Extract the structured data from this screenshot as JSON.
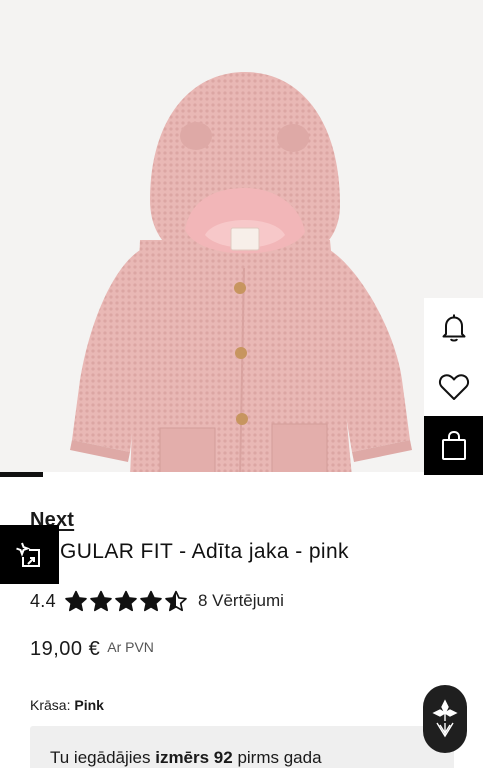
{
  "gallery": {
    "image_alt": "Pink knitted hooded baby cardigan",
    "slide_progress": 0.09
  },
  "side_actions": [
    {
      "name": "notify-button",
      "icon": "bell-icon"
    },
    {
      "name": "wishlist-button",
      "icon": "heart-icon"
    },
    {
      "name": "add-to-bag-button",
      "icon": "shopping-bag-icon"
    }
  ],
  "compare": {
    "icon": "compare-sparkle-icon"
  },
  "product": {
    "brand": "Next",
    "title": "REGULAR FIT - Adīta jaka - pink",
    "rating_value": "4.4",
    "rating_fraction": 0.88,
    "reviews_label": "8 Vērtējumi",
    "price": "19,00 €",
    "vat_label": "Ar PVN",
    "color_label": "Krāsa:",
    "color_value": "Pink"
  },
  "notice": {
    "pre": "Tu iegādājies ",
    "bold": "izmērs 92",
    "post": " pirms gada"
  },
  "assistant": {
    "icon": "assistant-logo-icon"
  },
  "colors": {
    "accent": "#000000",
    "hero_bg": "#f4f3f2",
    "knit": "#e9b7b4"
  }
}
